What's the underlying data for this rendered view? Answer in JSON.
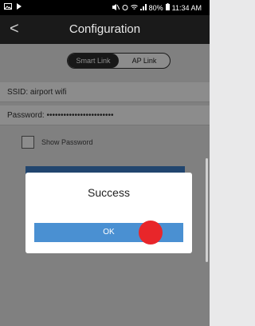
{
  "status_bar": {
    "icons_left": [
      "image-icon",
      "play-icon"
    ],
    "battery": "80%",
    "time": "11:34 AM"
  },
  "header": {
    "back_label": "<",
    "title": "Configuration"
  },
  "tabs": [
    {
      "label": "Smart Link",
      "active": true
    },
    {
      "label": "AP Link",
      "active": false
    }
  ],
  "form": {
    "ssid_label": "SSID:",
    "ssid_value": "airport wifi",
    "password_label": "Password:",
    "password_value": "••••••••••••••••••••••••",
    "show_password_label": "Show Password"
  },
  "dialog": {
    "title": "Success",
    "ok_label": "OK"
  },
  "colors": {
    "accent": "#4a90d2",
    "touch_indicator": "#e8262a"
  }
}
